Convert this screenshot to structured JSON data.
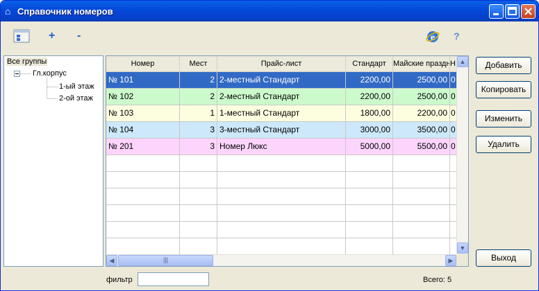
{
  "window": {
    "title": "Справочник номеров"
  },
  "toolbar": {
    "add_label": "+",
    "remove_label": "-",
    "help_label": "?"
  },
  "tree": {
    "root": "Все группы",
    "group": "Гл.корпус",
    "children": [
      "1-ый этаж",
      "2-ой этаж"
    ]
  },
  "table": {
    "columns": [
      "Номер",
      "Мест",
      "Прайс-лист",
      "Стандарт",
      "Майские праздн",
      "Н"
    ],
    "rows": [
      {
        "nomer": "№ 101",
        "mest": "2",
        "price_list": "2-местный Стандарт",
        "standart": "2200,00",
        "may": "2500,00",
        "extra": "0",
        "color": "#316ac5",
        "text_color": "#ffffff"
      },
      {
        "nomer": "№ 102",
        "mest": "2",
        "price_list": "2-местный Стандарт",
        "standart": "2200,00",
        "may": "2500,00",
        "extra": "0",
        "color": "#ccfacc",
        "text_color": "#000000"
      },
      {
        "nomer": "№ 103",
        "mest": "1",
        "price_list": "1-местный Стандарт",
        "standart": "1800,00",
        "may": "2200,00",
        "extra": "0",
        "color": "#fdfde0",
        "text_color": "#000000"
      },
      {
        "nomer": "№ 104",
        "mest": "3",
        "price_list": "3-местный Стандарт",
        "standart": "3000,00",
        "may": "3500,00",
        "extra": "0",
        "color": "#cde8fa",
        "text_color": "#000000"
      },
      {
        "nomer": "№ 201",
        "mest": "3",
        "price_list": "Номер Люкс",
        "standart": "5000,00",
        "may": "5500,00",
        "extra": "0",
        "color": "#fcd4fc",
        "text_color": "#000000"
      }
    ]
  },
  "buttons": {
    "add": "Добавить",
    "copy": "Копировать",
    "edit": "Изменить",
    "delete": "Удалить",
    "exit": "Выход"
  },
  "footer": {
    "filter_label": "фильтр",
    "filter_value": "",
    "total": "Всего: 5"
  },
  "colors": {
    "title_bar": "#0349d8",
    "selection": "#316ac5",
    "window_bg": "#ece9d8"
  }
}
